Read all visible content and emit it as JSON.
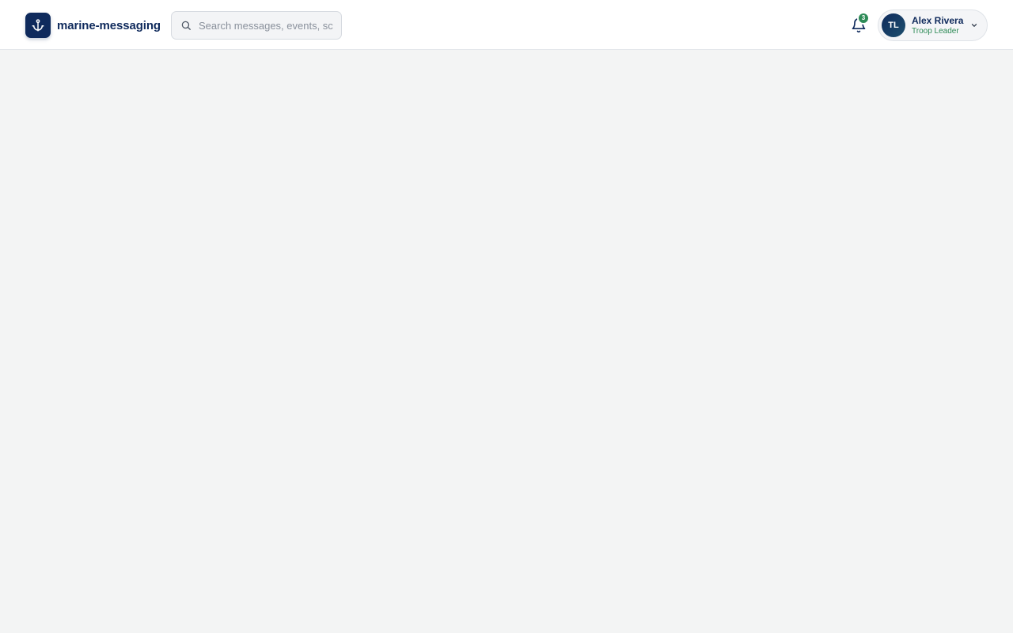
{
  "app": {
    "name": "marine-messaging",
    "logo_icon": "anchor-icon",
    "brand_color": "#0f2a5c",
    "accent_color": "#2e8b57"
  },
  "search": {
    "placeholder": "Search messages, events, sc",
    "value": "",
    "icon": "search-icon"
  },
  "notifications": {
    "icon": "bell-icon",
    "count": "3"
  },
  "user": {
    "initials": "TL",
    "name": "Alex Rivera",
    "role": "Troop Leader",
    "menu_icon": "chevron-down-icon"
  }
}
